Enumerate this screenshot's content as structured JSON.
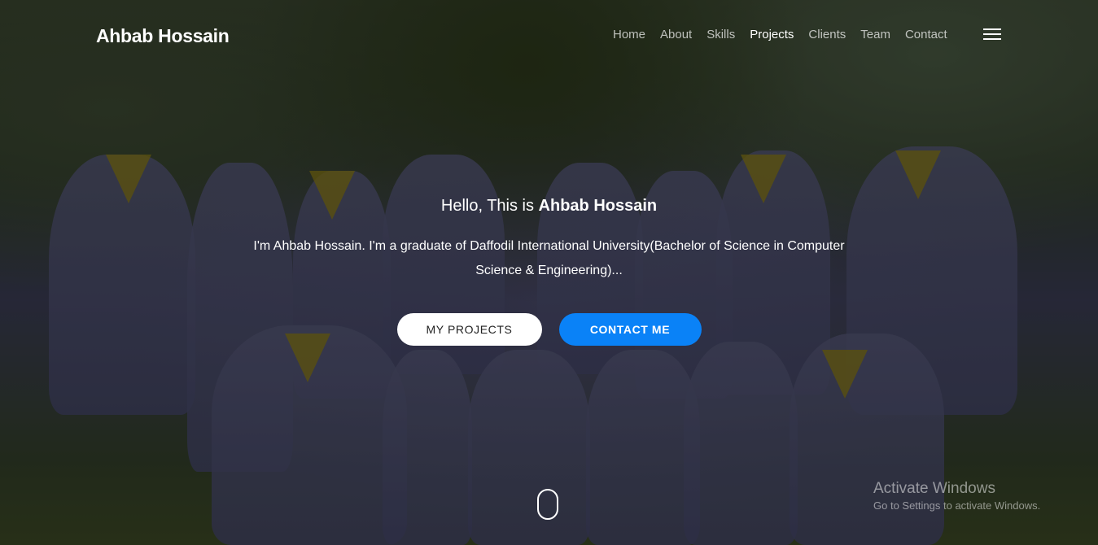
{
  "navbar": {
    "brand": "Ahbab Hossain",
    "links": [
      "Home",
      "About",
      "Skills",
      "Projects",
      "Clients",
      "Team",
      "Contact"
    ],
    "active": "Projects"
  },
  "hero": {
    "greeting_prefix": "Hello, This is ",
    "greeting_name": "Ahbab Hossain",
    "intro": "I'm Ahbab Hossain. I'm a graduate of Daffodil International University(Bachelor of Science in Computer Science & Engineering)...",
    "btn_projects": "MY PROJECTS",
    "btn_contact": "CONTACT ME",
    "background_image": "group-graduation-photo"
  },
  "watermark": {
    "title": "Activate Windows",
    "subtitle": "Go to Settings to activate Windows."
  },
  "colors": {
    "accent": "#0a82f7",
    "text": "#ffffff",
    "button_light": "#ffffff"
  }
}
